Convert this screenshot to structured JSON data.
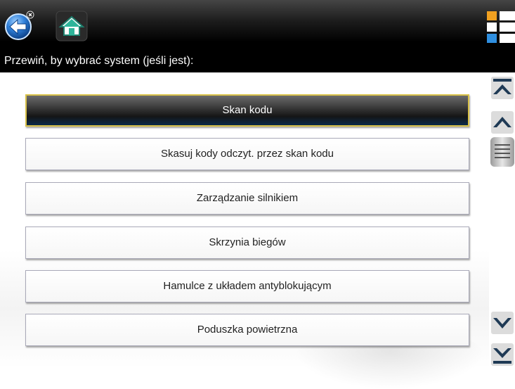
{
  "toolbar": {
    "back_icon": "back-arrow-icon",
    "home_icon": "home-icon",
    "view_icon": "view-list-icon"
  },
  "instruction": "Przewiń, by wybrać system (jeśli jest):",
  "list": {
    "items": [
      {
        "label": "Skan kodu",
        "selected": true
      },
      {
        "label": "Skasuj kody odczyt. przez skan kodu",
        "selected": false
      },
      {
        "label": "Zarządzanie silnikiem",
        "selected": false
      },
      {
        "label": "Skrzynia biegów",
        "selected": false
      },
      {
        "label": "Hamulce z układem antyblokującym",
        "selected": false
      },
      {
        "label": "Poduszka powietrzna",
        "selected": false
      }
    ]
  },
  "scrollbar": {
    "icons": [
      "scroll-to-top-icon",
      "scroll-up-icon",
      "scroll-down-icon",
      "scroll-to-bottom-icon"
    ]
  },
  "colors": {
    "toolbar_bg": "#000000",
    "selected_border": "#d9c24a",
    "back_button_blue": "#2f7fd8",
    "home_green": "#2fb59a"
  }
}
